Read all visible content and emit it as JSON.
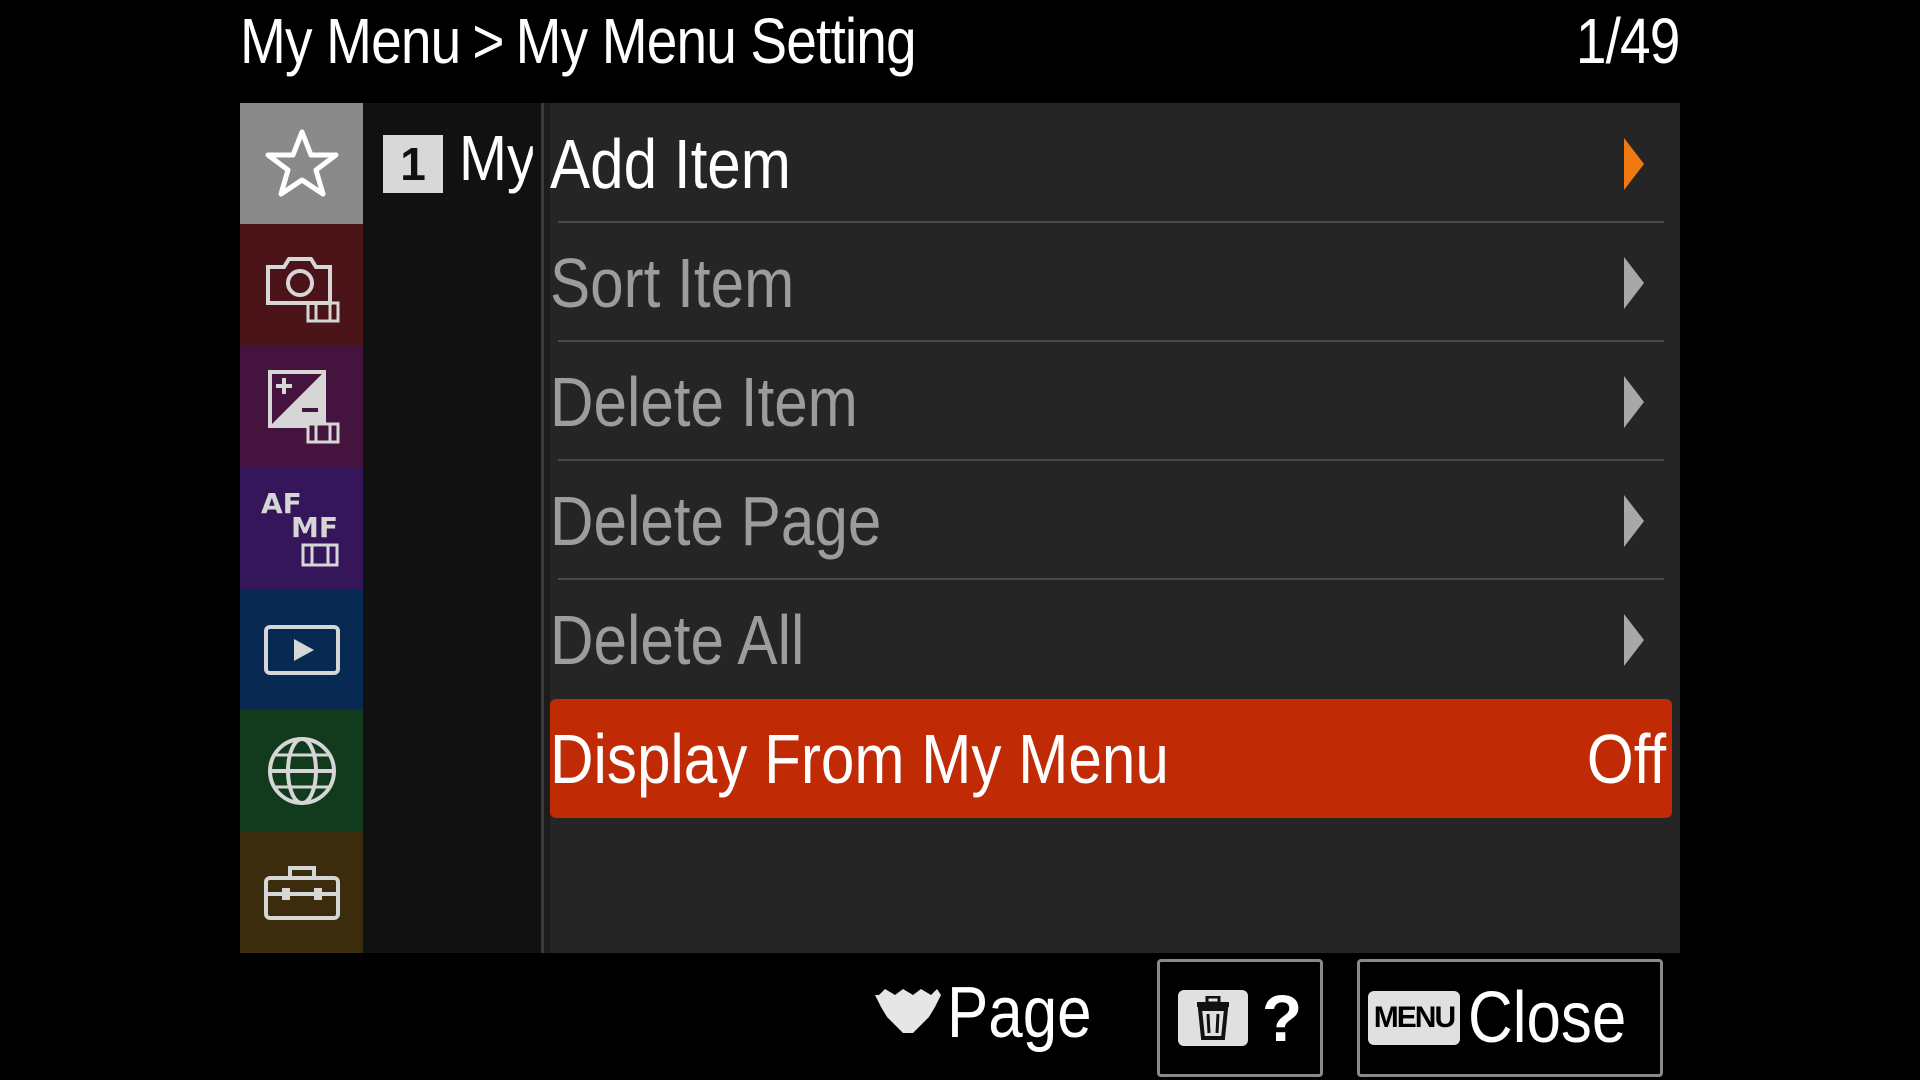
{
  "header": {
    "breadcrumb_root": "My Menu",
    "breadcrumb_separator": ">",
    "breadcrumb_current": "My Menu Setting",
    "page_indicator": "1/49"
  },
  "sidebar": {
    "categories": [
      {
        "name": "my-menu",
        "icon": "star-icon",
        "color": "#8a8a8a"
      },
      {
        "name": "shooting",
        "icon": "camera-movie-icon",
        "color": "#4a1418"
      },
      {
        "name": "exposure-color",
        "icon": "exposure-movie-icon",
        "color": "#45143e"
      },
      {
        "name": "focus",
        "icon": "af-mf-movie-icon",
        "color": "#35165a"
      },
      {
        "name": "playback",
        "icon": "play-icon",
        "color": "#082a52"
      },
      {
        "name": "network",
        "icon": "globe-icon",
        "color": "#123a1c"
      },
      {
        "name": "setup",
        "icon": "toolbox-icon",
        "color": "#3a2c0c"
      }
    ]
  },
  "subpage": {
    "number": "1",
    "label": "My"
  },
  "menu": {
    "items": [
      {
        "label": "Add Item"
      },
      {
        "label": "Sort Item"
      },
      {
        "label": "Delete Item"
      },
      {
        "label": "Delete Page"
      },
      {
        "label": "Delete All"
      },
      {
        "label": "Display From My Menu",
        "value": "Off"
      }
    ]
  },
  "footer": {
    "page_label": "Page",
    "help_label": "?",
    "menu_key": "MENU",
    "close_label": "Close"
  },
  "colors": {
    "selected": "#c02a04",
    "accent_arrow": "#f07a10"
  }
}
